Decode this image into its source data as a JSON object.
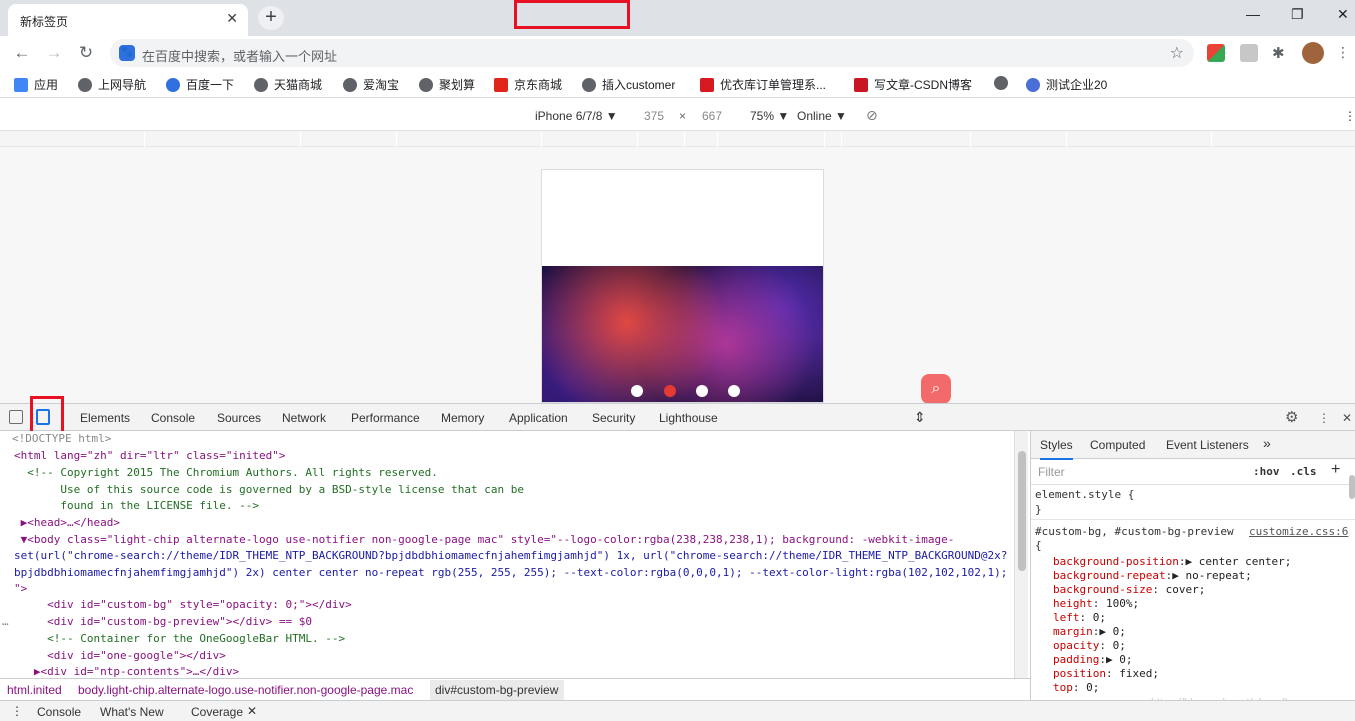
{
  "window": {
    "tab_title": "新标签页",
    "tab_close": "✕",
    "new_tab": "+",
    "minimize": "—",
    "restore": "❐",
    "close": "✕"
  },
  "toolbar": {
    "back": "←",
    "forward": "→",
    "reload": "↻",
    "omnibox_placeholder": "在百度中搜索，或者输入一个网址",
    "star": "☆"
  },
  "bookmarks": [
    {
      "label": "应用",
      "color": "#4285f4"
    },
    {
      "label": "上网导航",
      "color": "#5f6368"
    },
    {
      "label": "百度一下",
      "color": "#2f6fde"
    },
    {
      "label": "天猫商城",
      "color": "#5f6368"
    },
    {
      "label": "爱淘宝",
      "color": "#5f6368"
    },
    {
      "label": "聚划算",
      "color": "#5f6368"
    },
    {
      "label": "京东商城",
      "color": "#e1251b"
    },
    {
      "label": "插入customer",
      "color": "#5f6368"
    },
    {
      "label": "优衣库订单管理系...",
      "color": "#d71a21"
    },
    {
      "label": "写文章-CSDN博客",
      "color": "#c81623"
    },
    {
      "label": "",
      "color": "#5f6368"
    },
    {
      "label": "测试企业20",
      "color": "#4b6fd6"
    }
  ],
  "device_toolbar": {
    "device": "iPhone 6/7/8 ▼",
    "width": "375",
    "times": "×",
    "height": "667",
    "zoom": "75% ▼",
    "network": "Online ▼",
    "rotate": "⃠",
    "more": "⋮"
  },
  "devtools": {
    "tabs": [
      "Elements",
      "Console",
      "Sources",
      "Network",
      "Performance",
      "Memory",
      "Application",
      "Security",
      "Lighthouse"
    ],
    "settings": "⚙",
    "more": "⋮",
    "close": "✕",
    "resize": "⇕"
  },
  "dom_lines": [
    {
      "cls": "gr",
      "text": "<!DOCTYPE html>"
    },
    {
      "cls": "tg",
      "text": "<html lang=\"zh\" dir=\"ltr\" class=\"inited\">"
    },
    {
      "cls": "cm",
      "text": "  <!-- Copyright 2015 The Chromium Authors. All rights reserved."
    },
    {
      "cls": "cm",
      "text": "       Use of this source code is governed by a BSD-style license that can be"
    },
    {
      "cls": "cm",
      "text": "       found in the LICENSE file. -->"
    },
    {
      "cls": "tg",
      "text": " ▶<head>…</head>"
    },
    {
      "cls": "tg",
      "text": " ▼<body class=\"light-chip alternate-logo use-notifier non-google-page mac\" style=\"--logo-color:rgba(238,238,238,1); background: -webkit-image-"
    },
    {
      "cls": "av",
      "text": "set(url(\"chrome-search://theme/IDR_THEME_NTP_BACKGROUND?bpjdbdbhiomamecfnjahemfimgjamhjd\") 1x, url(\"chrome-search://theme/IDR_THEME_NTP_BACKGROUND@2x?"
    },
    {
      "cls": "av",
      "text": "bpjdbdbhiomamecfnjahemfimgjamhjd\") 2x) center center no-repeat rgb(255, 255, 255); --text-color:rgba(0,0,0,1); --text-color-light:rgba(102,102,102,1);"
    },
    {
      "cls": "tg",
      "text": "\">"
    },
    {
      "cls": "tg",
      "text": "     <div id=\"custom-bg\" style=\"opacity: 0;\"></div>"
    },
    {
      "cls": "tg",
      "text": "     <div id=\"custom-bg-preview\"></div> == $0"
    },
    {
      "cls": "cm",
      "text": "     <!-- Container for the OneGoogleBar HTML. -->"
    },
    {
      "cls": "tg",
      "text": "     <div id=\"one-google\"></div>"
    },
    {
      "cls": "tg",
      "text": "   ▶<div id=\"ntp-contents\">…</div>"
    }
  ],
  "dom_ellipsis": "…",
  "breadcrumbs": [
    "html.inited",
    "body.light-chip.alternate-logo.use-notifier.non-google-page.mac",
    "div#custom-bg-preview"
  ],
  "drawer": {
    "tabs": [
      "Console",
      "What's New",
      "Coverage"
    ],
    "close": "✕",
    "menu": "⋮"
  },
  "styles": {
    "tabs": [
      "Styles",
      "Computed",
      "Event Listeners",
      "»"
    ],
    "filter_placeholder": "Filter",
    "hov": ":hov",
    ".cls": ".cls",
    "plus": "+",
    "element_style": "element.style {",
    "close_brace": "}",
    "rule_selector": "#custom-bg, #custom-bg-preview",
    "rule_source": "customize.css:6",
    "open_brace": "{",
    "declarations": [
      {
        "name": "background-position",
        "value": "▶ center center;"
      },
      {
        "name": "background-repeat",
        "value": "▶ no-repeat;"
      },
      {
        "name": "background-size",
        "value": " cover;"
      },
      {
        "name": "height",
        "value": " 100%;"
      },
      {
        "name": "left",
        "value": " 0;"
      },
      {
        "name": "margin",
        "value": "▶ 0;"
      },
      {
        "name": "opacity",
        "value": " 0;"
      },
      {
        "name": "padding",
        "value": "▶ 0;"
      },
      {
        "name": "position",
        "value": " fixed;"
      },
      {
        "name": "top",
        "value": " 0;"
      }
    ],
    "watermark": "https://blog.csdn.net/abcnull"
  }
}
